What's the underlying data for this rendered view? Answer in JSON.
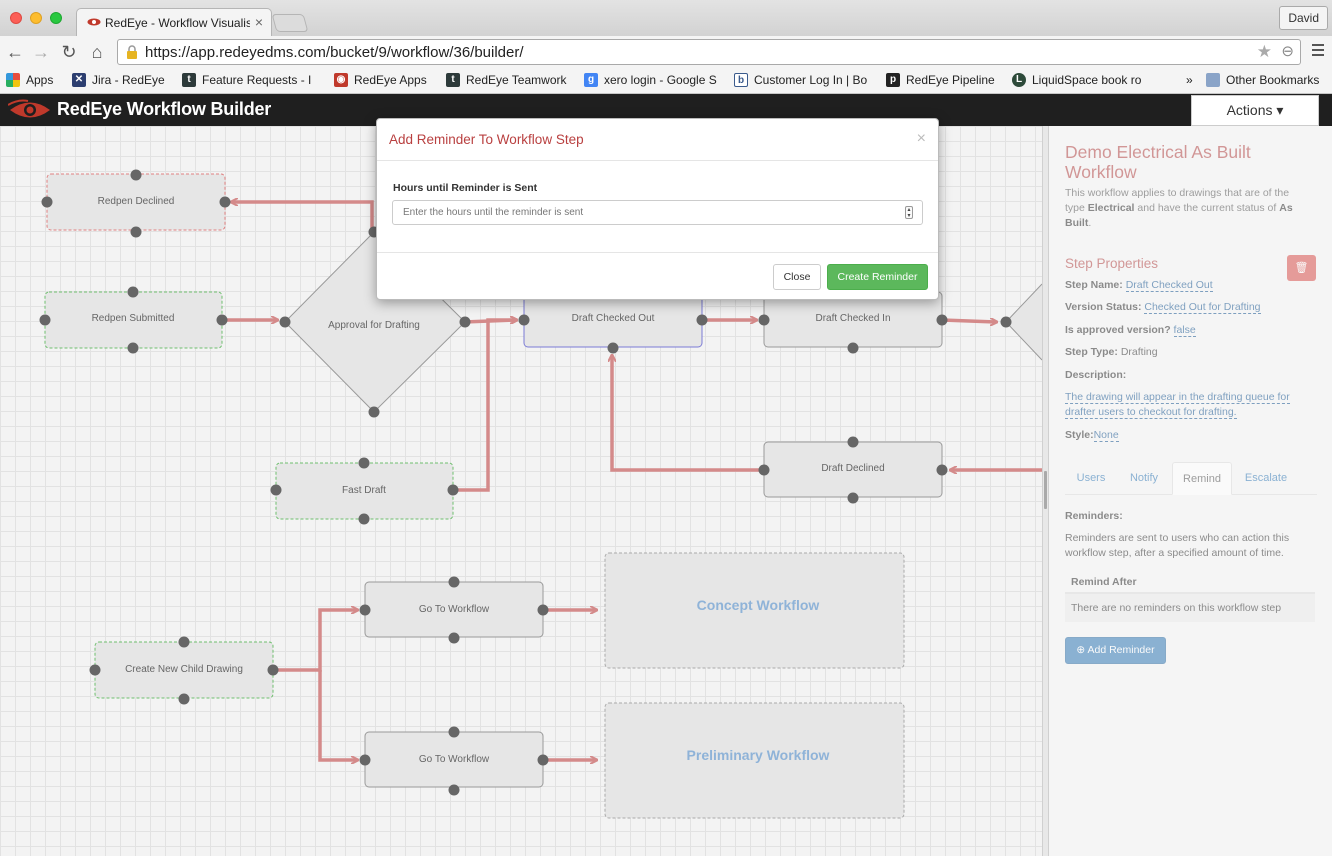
{
  "browser": {
    "tab_title": "RedEye - Workflow Visualis",
    "user": "David",
    "url": "https://app.redeyedms.com/bucket/9/workflow/36/builder/",
    "bookmarks": [
      {
        "label": "Apps",
        "icon": "apps-grid-icon"
      },
      {
        "label": "Jira - RedEye",
        "icon": "jira-icon"
      },
      {
        "label": "Feature Requests - I",
        "icon": "teamwork-icon"
      },
      {
        "label": "RedEye Apps",
        "icon": "redeye-icon"
      },
      {
        "label": "RedEye Teamwork",
        "icon": "teamwork-icon"
      },
      {
        "label": "xero login - Google S",
        "icon": "google-icon"
      },
      {
        "label": "Customer Log In | Bo",
        "icon": "b-icon"
      },
      {
        "label": "RedEye Pipeline",
        "icon": "pipedrive-icon"
      },
      {
        "label": "LiquidSpace book ro",
        "icon": "liquidspace-icon"
      }
    ],
    "overflow": "»",
    "other_bookmarks": "Other Bookmarks"
  },
  "app": {
    "title": "RedEye Workflow Builder",
    "actions_label": "Actions ▾"
  },
  "canvas": {
    "nodes": {
      "redpen_declined": "Redpen Declined",
      "redpen_submitted": "Redpen Submitted",
      "approval_for_drafting": "Approval for Drafting",
      "draft_checked_out": "Draft Checked Out",
      "draft_checked_in": "Draft Checked In",
      "draft_declined": "Draft Declined",
      "fast_draft": "Fast Draft",
      "go_to_workflow_1": "Go To Workflow",
      "go_to_workflow_2": "Go To Workflow",
      "create_new_child_drawing": "Create New Child Drawing",
      "concept_workflow": "Concept Workflow",
      "preliminary_workflow": "Preliminary Workflow"
    },
    "colors": {
      "edge": "#d48a8a",
      "node_fill": "#e6e6e6",
      "port": "#666666",
      "selected_border": "#7b7bd6",
      "start_border": "#6fbf6f",
      "declined_border": "#e08080"
    }
  },
  "sidebar": {
    "workflow_title": "Demo Electrical As Built Workflow",
    "desc_prefix": "This workflow applies to drawings that are of the type ",
    "desc_type": "Electrical",
    "desc_middle": " and have the current status of ",
    "desc_status": "As Built",
    "desc_end": ".",
    "step_heading": "Step Properties",
    "step_name_label": "Step Name:",
    "step_name": "Draft Checked Out",
    "version_status_label": "Version Status:",
    "version_status": "Checked Out for Drafting",
    "approved_label": "Is approved version?",
    "approved": "false",
    "step_type_label": "Step Type:",
    "step_type": "Drafting",
    "description_label": "Description:",
    "description": "The drawing will appear in the drafting queue for drafter users to checkout for drafting.",
    "style_label": "Style:",
    "style": "None",
    "tabs": [
      "Users",
      "Notify",
      "Remind",
      "Escalate"
    ],
    "active_tab": "Remind",
    "reminders_label": "Reminders:",
    "reminders_text": "Reminders are sent to users who can action this workflow step, after a specified amount of time.",
    "table_header": "Remind After",
    "table_empty": "There are no reminders on this workflow step",
    "add_button": "⊕ Add Reminder"
  },
  "modal": {
    "title": "Add Reminder To Workflow Step",
    "close_icon": "×",
    "field_label": "Hours until Reminder is Sent",
    "field_placeholder": "Enter the hours until the reminder is sent",
    "field_value": "",
    "close_button": "Close",
    "create_button": "Create Reminder"
  }
}
